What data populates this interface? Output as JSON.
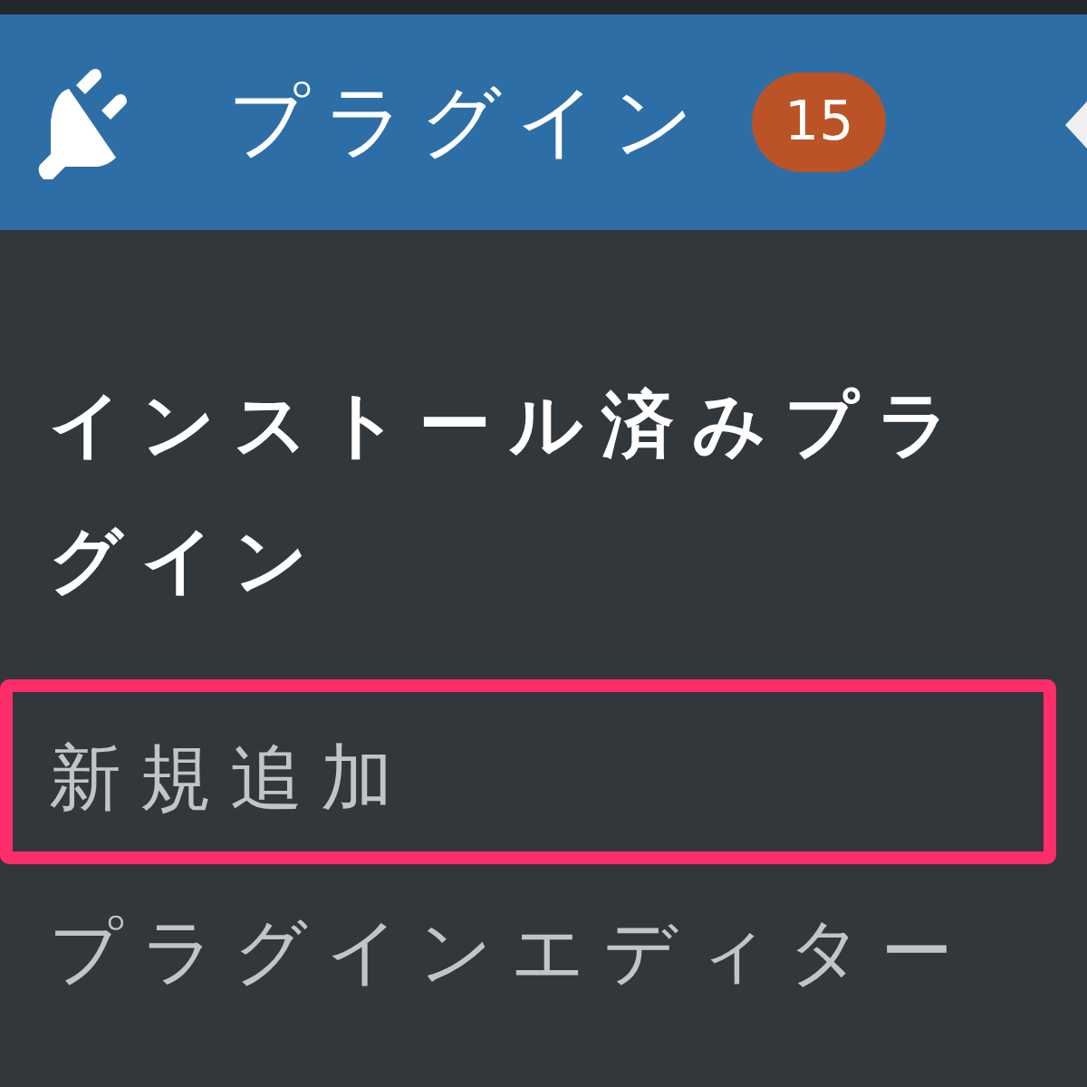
{
  "menu": {
    "title": "プラグイン",
    "badge": "15",
    "current": true
  },
  "submenu": [
    {
      "label": "インストール済みプラグイン",
      "selected": true,
      "highlighted": false
    },
    {
      "label": "新規追加",
      "selected": false,
      "highlighted": true
    },
    {
      "label": "プラグインエディター",
      "selected": false,
      "highlighted": false
    }
  ]
}
